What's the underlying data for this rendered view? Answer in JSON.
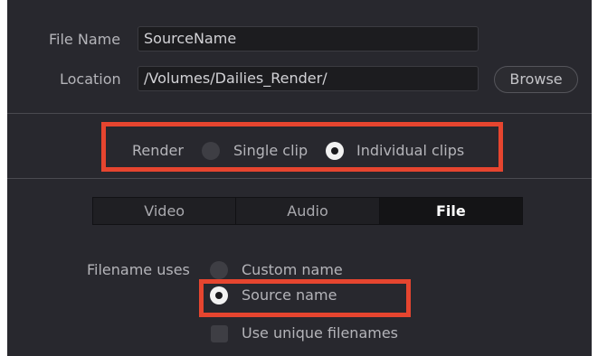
{
  "file_name": {
    "label": "File Name",
    "value": "SourceName"
  },
  "location": {
    "label": "Location",
    "value": "/Volumes/Dailies_Render/",
    "browse_label": "Browse"
  },
  "render": {
    "label": "Render",
    "options": [
      {
        "label": "Single clip",
        "selected": false
      },
      {
        "label": "Individual clips",
        "selected": true
      }
    ]
  },
  "tabs": [
    {
      "label": "Video",
      "active": false
    },
    {
      "label": "Audio",
      "active": false
    },
    {
      "label": "File",
      "active": true
    }
  ],
  "filename_uses": {
    "label": "Filename uses",
    "options": [
      {
        "label": "Custom name",
        "selected": false
      },
      {
        "label": "Source name",
        "selected": true
      }
    ],
    "unique": {
      "label": "Use unique filenames",
      "checked": false
    }
  },
  "colors": {
    "panel_background": "#28282e",
    "highlight_border": "#e6452f",
    "radio_selected": "#f2f2f2"
  }
}
